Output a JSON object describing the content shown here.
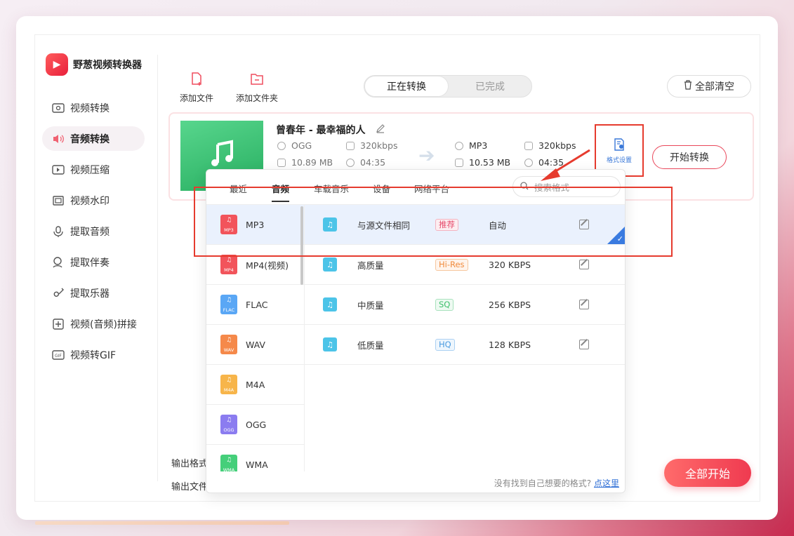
{
  "app": {
    "title": "野葱视频转换器"
  },
  "sidebar": {
    "items": [
      {
        "label": "视频转换",
        "icon": "video-convert-icon"
      },
      {
        "label": "音频转换",
        "icon": "audio-convert-icon",
        "active": true
      },
      {
        "label": "视频压缩",
        "icon": "video-compress-icon"
      },
      {
        "label": "视频水印",
        "icon": "video-watermark-icon"
      },
      {
        "label": "提取音频",
        "icon": "extract-audio-icon"
      },
      {
        "label": "提取伴奏",
        "icon": "extract-accompaniment-icon"
      },
      {
        "label": "提取乐器",
        "icon": "extract-instrument-icon"
      },
      {
        "label": "视频(音频)拼接",
        "icon": "merge-icon"
      },
      {
        "label": "视频转GIF",
        "icon": "gif-icon"
      }
    ]
  },
  "toolbar": {
    "add_file": "添加文件",
    "add_folder": "添加文件夹",
    "tabs": [
      "正在转换",
      "已完成"
    ],
    "clear_all": "全部清空"
  },
  "file": {
    "name": "曾春年 - 最幸福的人",
    "source": {
      "format": "OGG",
      "bitrate": "320kbps",
      "size": "10.89 MB",
      "duration": "04:35"
    },
    "target": {
      "format": "MP3",
      "bitrate": "320kbps",
      "size": "10.53 MB",
      "duration": "04:35"
    },
    "format_setting": "格式设置",
    "start": "开始转换"
  },
  "bottom": {
    "output_format": "输出格式",
    "output_file": "输出文件",
    "start_all": "全部开始"
  },
  "popup": {
    "tabs": [
      "最近",
      "音频",
      "车载音乐",
      "设备",
      "网络平台"
    ],
    "active_tab": "音频",
    "search_placeholder": "搜索格式",
    "formats": [
      {
        "name": "MP3",
        "color": "#f2545b"
      },
      {
        "name": "MP4(视频)",
        "color": "#f2545b"
      },
      {
        "name": "FLAC",
        "color": "#5aa7f5"
      },
      {
        "name": "WAV",
        "color": "#f5894a"
      },
      {
        "name": "M4A",
        "color": "#f7b54a"
      },
      {
        "name": "OGG",
        "color": "#8b7cf0"
      },
      {
        "name": "WMA",
        "color": "#45cf7a"
      }
    ],
    "qualities": [
      {
        "name": "与源文件相同",
        "badge": "推荐",
        "badge_color": "#e64a6a",
        "rate": "自动"
      },
      {
        "name": "高质量",
        "badge": "Hi-Res",
        "badge_color": "#f08a3c",
        "rate": "320 KBPS"
      },
      {
        "name": "中质量",
        "badge": "SQ",
        "badge_color": "#3cbf6a",
        "rate": "256 KBPS"
      },
      {
        "name": "低质量",
        "badge": "HQ",
        "badge_color": "#4a9be0",
        "rate": "128 KBPS"
      }
    ],
    "footer_text": "没有找到自己想要的格式?",
    "footer_link": "点这里"
  }
}
